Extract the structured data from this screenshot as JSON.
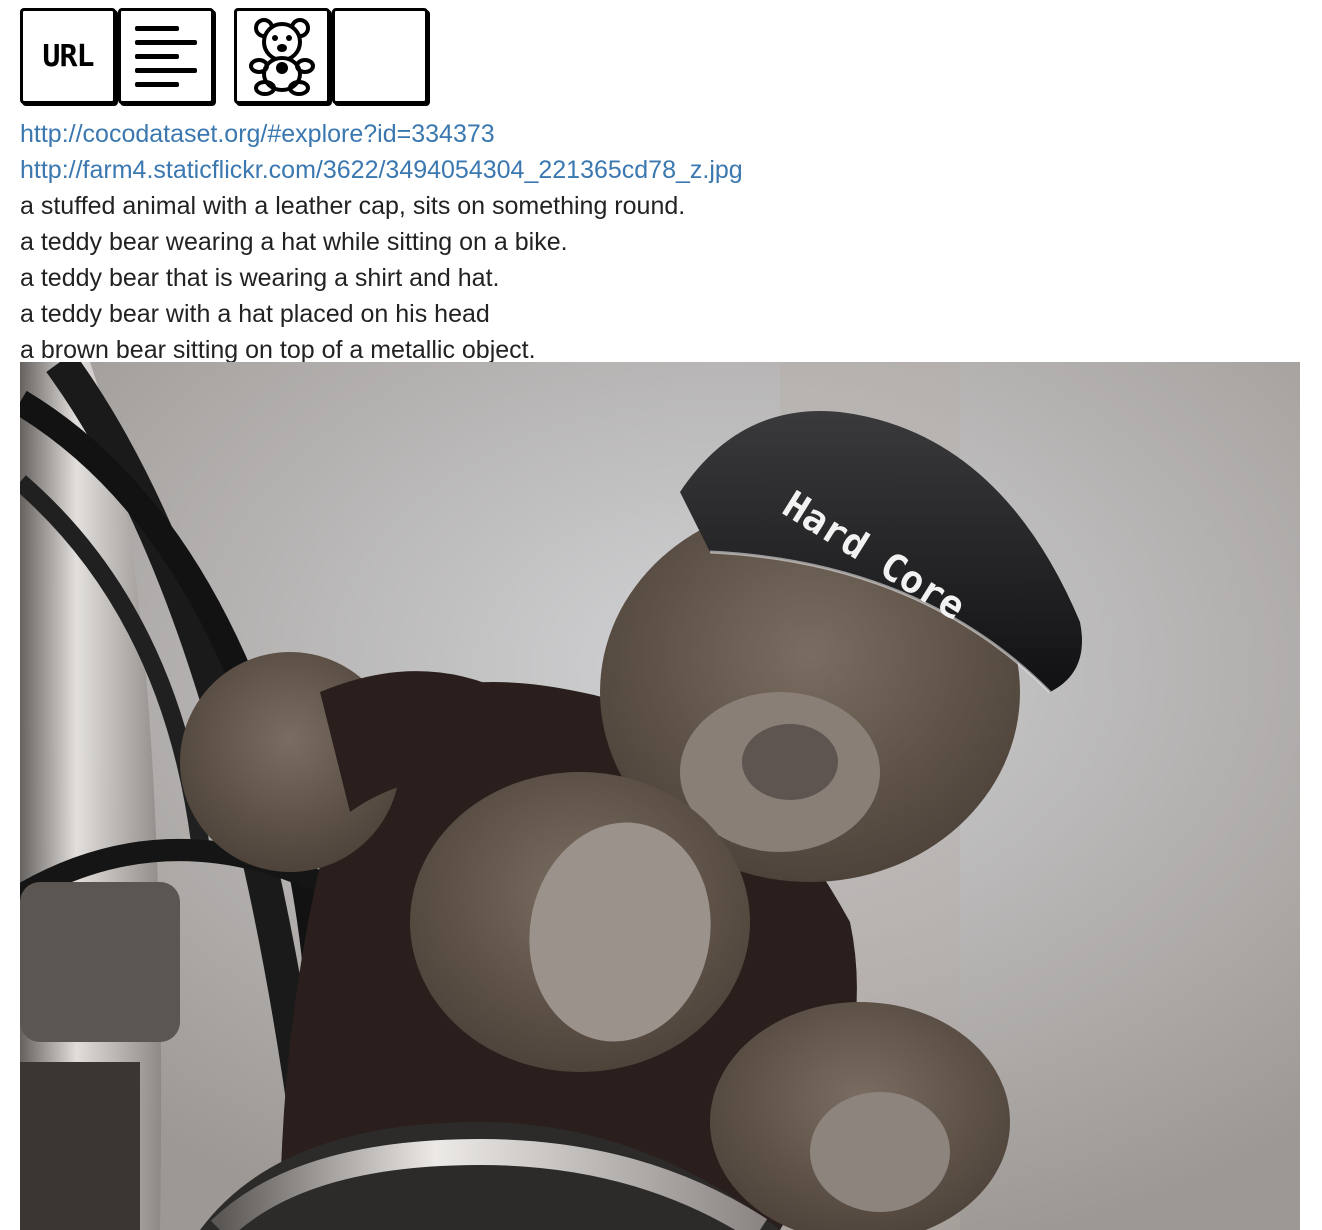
{
  "toolbar": {
    "url_button_label": "URL",
    "icons": [
      "url-icon",
      "text-lines-icon",
      "teddy-bear-icon",
      "blank-icon"
    ]
  },
  "links": {
    "coco_explore": "http://cocodataset.org/#explore?id=334373",
    "flickr_image": "http://farm4.staticflickr.com/3622/3494054304_221365cd78_z.jpg"
  },
  "captions": [
    "a stuffed animal with a leather cap, sits on something round.",
    "a teddy bear wearing a hat while sitting on a bike.",
    "a teddy bear that is wearing a shirt and hat.",
    "a teddy bear with a hat placed on his head",
    "a brown bear sitting on top of a metallic object."
  ],
  "photo": {
    "cap_text": "Hard Core",
    "colors": {
      "fur": "#6b5e53",
      "fur_dark": "#4a3f37",
      "cap": "#1c1c1e",
      "shirt": "#2a1f1c",
      "chrome": "#d8d8da",
      "background": "#b9b9bd"
    }
  },
  "colors": {
    "link": "#3b78b0",
    "text": "#222222"
  }
}
